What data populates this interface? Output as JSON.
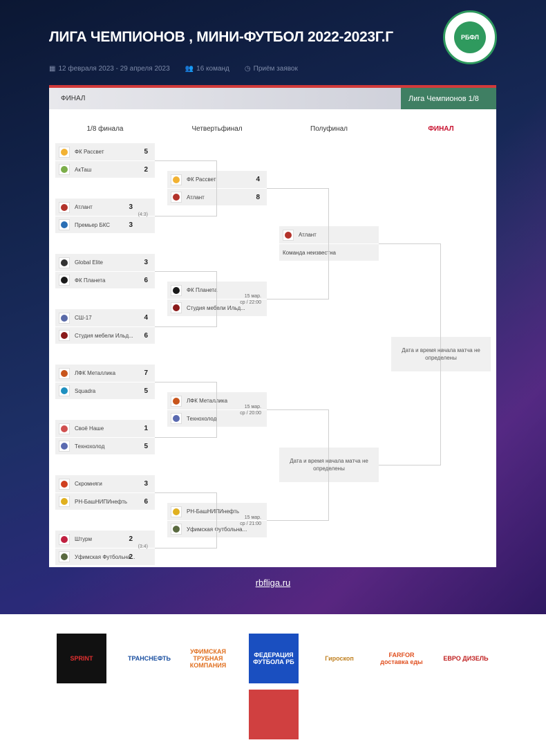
{
  "header": {
    "title": "ЛИГА ЧЕМПИОНОВ , МИНИ-ФУТБОЛ 2022-2023Г.Г",
    "dates": "12 февраля 2023 - 29 апреля 2023",
    "teams": "16 команд",
    "status": "Приём заявок",
    "logo_text": "РБФЛ"
  },
  "bracket": {
    "bar_title": "ФИНАЛ",
    "tab": "Лига Чемпионов 1/8",
    "rounds": [
      "1/8 финала",
      "Четвертьфинал",
      "Полуфинал",
      "ФИНАЛ"
    ],
    "r16": [
      {
        "teams": [
          {
            "name": "ФК Рассвет",
            "score": "5",
            "logo": "#f2b233"
          },
          {
            "name": "АкТаш",
            "score": "2",
            "logo": "#7cae4a"
          }
        ]
      },
      {
        "teams": [
          {
            "name": "Атлант",
            "score": "3",
            "logo": "#b3332b"
          },
          {
            "name": "Премьер БКС",
            "score": "3",
            "logo": "#2a6fb5"
          }
        ],
        "pen": "(4:3)"
      },
      {
        "teams": [
          {
            "name": "Global Elite",
            "score": "3",
            "logo": "#333333"
          },
          {
            "name": "ФК Планета",
            "score": "6",
            "logo": "#1a1a1a"
          }
        ]
      },
      {
        "teams": [
          {
            "name": "СШ-17",
            "score": "4",
            "logo": "#5a6aa8"
          },
          {
            "name": "Студия мебели Ильд...",
            "score": "6",
            "logo": "#8a1a1a"
          }
        ]
      },
      {
        "teams": [
          {
            "name": "ЛФК Металлика",
            "score": "7",
            "logo": "#c8551c"
          },
          {
            "name": "Squadra",
            "score": "5",
            "logo": "#1e90c0"
          }
        ]
      },
      {
        "teams": [
          {
            "name": "Своё Наше",
            "score": "1",
            "logo": "#d05050"
          },
          {
            "name": "Технохолод",
            "score": "5",
            "logo": "#5a6ab0"
          }
        ]
      },
      {
        "teams": [
          {
            "name": "Скромняги",
            "score": "3",
            "logo": "#d04020"
          },
          {
            "name": "РН-БашНИПИнефть",
            "score": "6",
            "logo": "#e0b020"
          }
        ]
      },
      {
        "teams": [
          {
            "name": "Штурм",
            "score": "2",
            "logo": "#c02040"
          },
          {
            "name": "Уфимская Футбольна...",
            "score": "2",
            "logo": "#5a6a40"
          }
        ],
        "pen": "(3:4)"
      }
    ],
    "qf": [
      {
        "teams": [
          {
            "name": "ФК Рассвет",
            "score": "4",
            "logo": "#f2b233"
          },
          {
            "name": "Атлант",
            "score": "8",
            "logo": "#b3332b"
          }
        ]
      },
      {
        "teams": [
          {
            "name": "ФК Планета",
            "logo": "#1a1a1a"
          },
          {
            "name": "Студия мебели Ильд...",
            "logo": "#8a1a1a"
          }
        ],
        "date": "15 мар.",
        "time": "ср / 22:00"
      },
      {
        "teams": [
          {
            "name": "ЛФК Металлика",
            "logo": "#c8551c"
          },
          {
            "name": "Технохолод",
            "logo": "#5a6ab0"
          }
        ],
        "date": "15 мар.",
        "time": "ср / 20:00"
      },
      {
        "teams": [
          {
            "name": "РН-БашНИПИнефть",
            "logo": "#e0b020"
          },
          {
            "name": "Уфимская Футбольна...",
            "logo": "#5a6a40"
          }
        ],
        "date": "15 мар.",
        "time": "ср / 21:00"
      }
    ],
    "sf": [
      {
        "teams": [
          {
            "name": "Атлант",
            "logo": "#b3332b"
          },
          {
            "name": "Команда неизвестна"
          }
        ]
      },
      {
        "unknown": "Дата и время начала матча не определены"
      }
    ],
    "final": {
      "unknown": "Дата и время начала матча не определены"
    }
  },
  "footer": {
    "site": "rbfliga.ru",
    "sponsors": [
      {
        "name": "SPRINT",
        "bg": "#111111",
        "fg": "#e03030"
      },
      {
        "name": "ТРАНСНЕФТЬ",
        "bg": "#ffffff",
        "fg": "#1a4fa0"
      },
      {
        "name": "УФИМСКАЯ ТРУБНАЯ КОМПАНИЯ",
        "bg": "#ffffff",
        "fg": "#e07020"
      },
      {
        "name": "ФЕДЕРАЦИЯ ФУТБОЛА РБ",
        "bg": "#1a4fc0",
        "fg": "#ffffff"
      },
      {
        "name": "Гироскоп",
        "bg": "#ffffff",
        "fg": "#c08020"
      },
      {
        "name": "FARFOR доставка еды",
        "bg": "#ffffff",
        "fg": "#e05020"
      },
      {
        "name": "ЕВРО ДИЗЕЛЬ",
        "bg": "#ffffff",
        "fg": "#c02020"
      },
      {
        "name": "",
        "bg": "#d04040",
        "fg": "#ffffff"
      }
    ]
  },
  "colors": {
    "accent_red": "#d23a3a",
    "tab_green": "#3f7f63",
    "final_red": "#c8102e"
  }
}
